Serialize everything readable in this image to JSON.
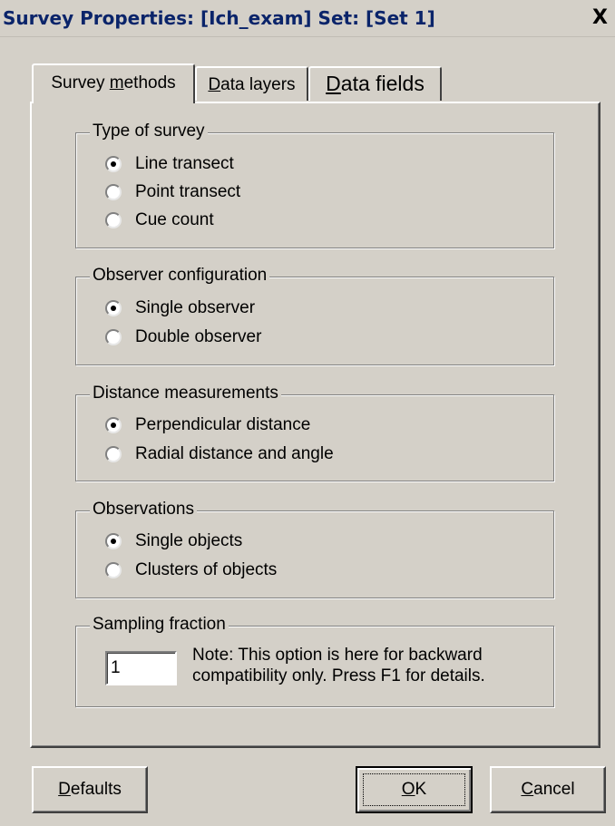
{
  "window": {
    "title": "Survey Properties: [Ich_exam] Set: [Set 1]",
    "close_label": "X"
  },
  "tabs": [
    {
      "pre": "Survey ",
      "mnemonic": "m",
      "post": "ethods",
      "active": true
    },
    {
      "pre": "",
      "mnemonic": "D",
      "post": "ata layers",
      "active": false
    },
    {
      "pre": "",
      "mnemonic": "D",
      "post": "ata fields",
      "active": false
    }
  ],
  "type_of_survey": {
    "legend": "Type of survey",
    "options": [
      "Line transect",
      "Point transect",
      "Cue count"
    ],
    "selected": "Line transect"
  },
  "observer_configuration": {
    "legend": "Observer configuration",
    "options": [
      "Single observer",
      "Double observer"
    ],
    "selected": "Single observer"
  },
  "distance_measurements": {
    "legend": "Distance measurements",
    "options": [
      "Perpendicular distance",
      "Radial distance and angle"
    ],
    "selected": "Perpendicular distance"
  },
  "observations": {
    "legend": "Observations",
    "options": [
      "Single objects",
      "Clusters of objects"
    ],
    "selected": "Single objects"
  },
  "sampling_fraction": {
    "legend": "Sampling fraction",
    "value": "1",
    "note_line1": "Note: This option is here for backward",
    "note_line2": "compatibility only.  Press F1 for details."
  },
  "buttons": {
    "defaults": {
      "pre": "",
      "mnemonic": "D",
      "post": "efaults"
    },
    "ok": {
      "pre": "",
      "mnemonic": "O",
      "post": "K"
    },
    "cancel": {
      "pre": "",
      "mnemonic": "C",
      "post": "ancel"
    }
  },
  "colors": {
    "face": "#d4d0c8",
    "title_text": "#0a246a"
  }
}
